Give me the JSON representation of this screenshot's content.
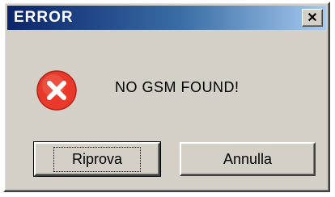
{
  "window": {
    "title": "ERROR",
    "close_label": "✕"
  },
  "icon": {
    "name": "error-icon",
    "color": "#e8392a"
  },
  "message": "NO GSM FOUND!",
  "buttons": {
    "retry_label": "Riprova",
    "cancel_label": "Annulla"
  }
}
